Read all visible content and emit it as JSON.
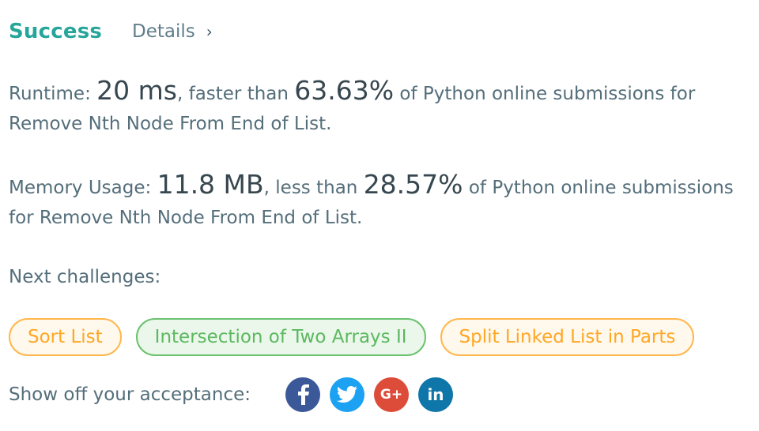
{
  "header": {
    "status": "Success",
    "details_label": "Details",
    "details_chevron": "›"
  },
  "runtime": {
    "label": "Runtime: ",
    "value": "20 ms",
    "middle": ", faster than ",
    "percent": "63.63%",
    "suffix": " of Python online submissions for Remove Nth Node From End of List."
  },
  "memory": {
    "label": "Memory Usage: ",
    "value": "11.8 MB",
    "middle": ", less than ",
    "percent": "28.57%",
    "suffix": " of Python online submissions for Remove Nth Node From End of List."
  },
  "next": {
    "label": "Next challenges:",
    "challenges": [
      {
        "title": "Sort List",
        "difficulty_color": "#ffa726"
      },
      {
        "title": "Intersection of Two Arrays II",
        "difficulty_color": "#5cb860"
      },
      {
        "title": "Split Linked List in Parts",
        "difficulty_color": "#ffa726"
      }
    ]
  },
  "share": {
    "label": "Show off your acceptance:",
    "networks": [
      {
        "icon": "facebook-icon",
        "color": "#3b5998"
      },
      {
        "icon": "twitter-icon",
        "color": "#1da1f2"
      },
      {
        "icon": "google-plus-icon",
        "color": "#dd4b39"
      },
      {
        "icon": "linkedin-icon",
        "color": "#0e76a8"
      }
    ],
    "google_text": "G+",
    "linkedin_text": "in"
  }
}
